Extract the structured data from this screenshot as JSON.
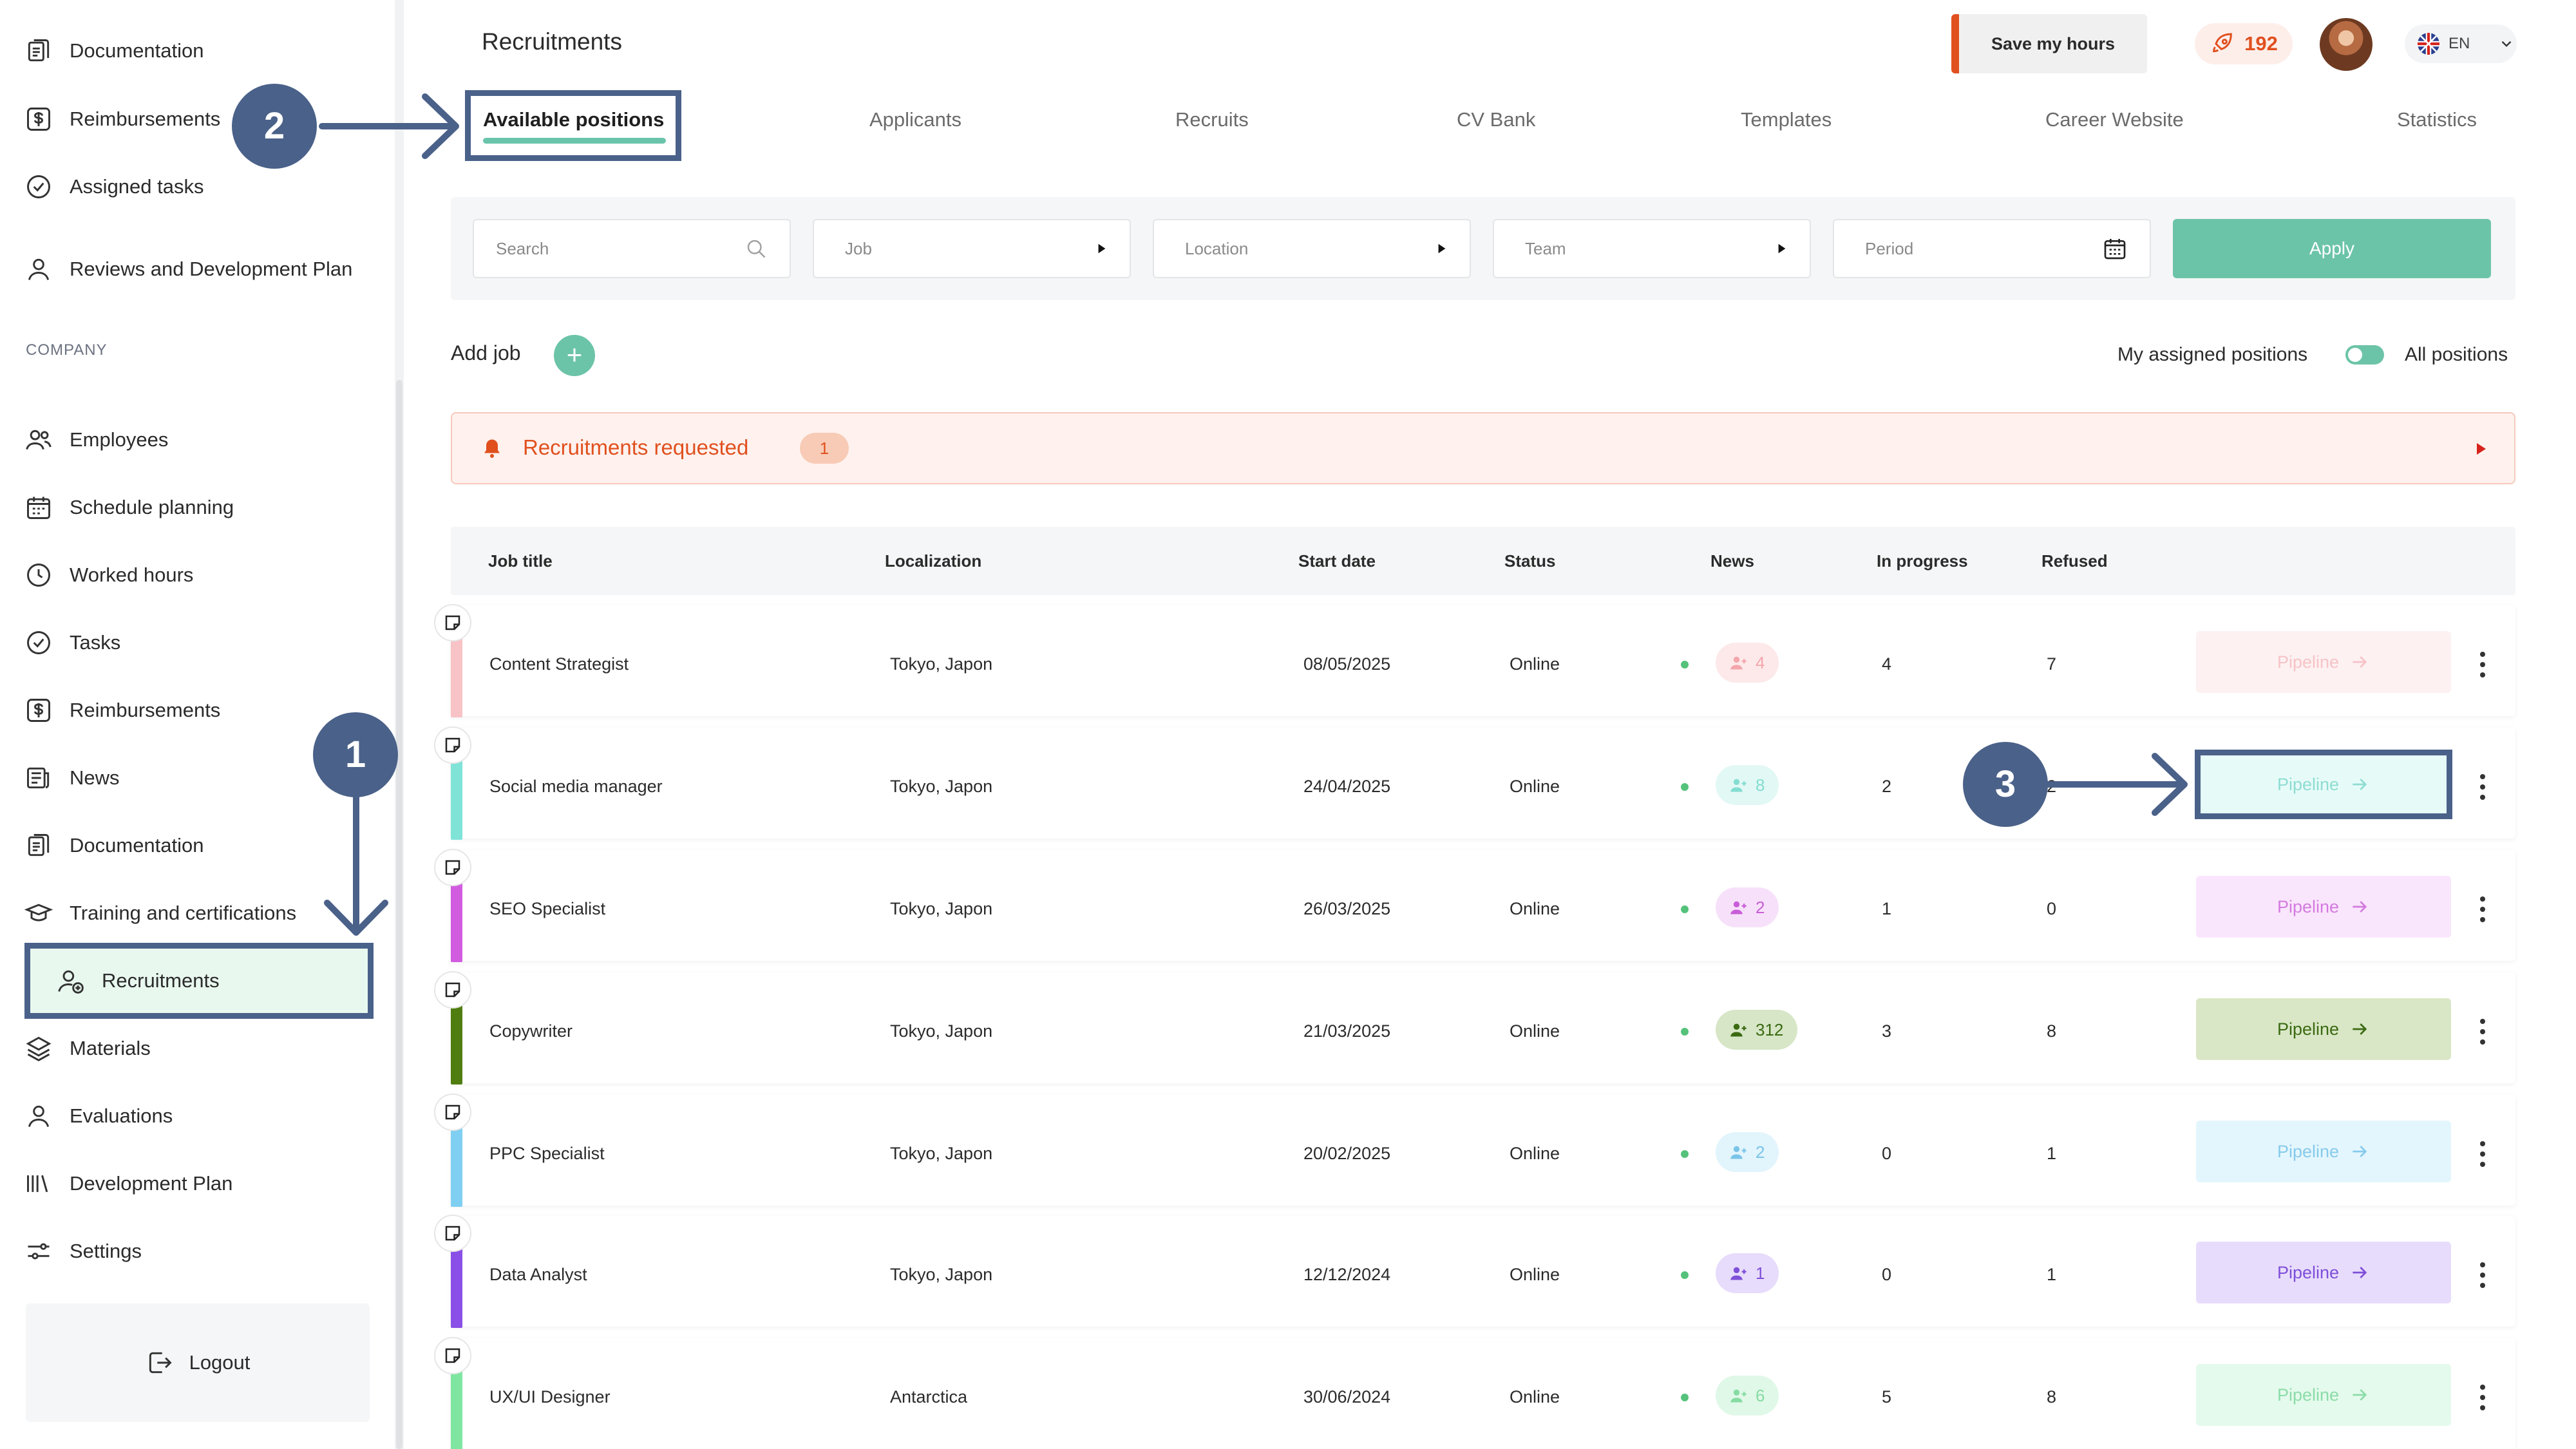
{
  "header": {
    "title": "Recruitments",
    "save_hours_label": "Save my hours",
    "points": "192",
    "language": "EN"
  },
  "tabs": [
    {
      "label": "Available positions"
    },
    {
      "label": "Applicants"
    },
    {
      "label": "Recruits"
    },
    {
      "label": "CV Bank"
    },
    {
      "label": "Templates"
    },
    {
      "label": "Career Website"
    },
    {
      "label": "Statistics"
    }
  ],
  "sidebar": {
    "top_items": [
      {
        "label": "Documentation",
        "icon": "documentation-icon"
      },
      {
        "label": "Reimbursements",
        "icon": "dollar-icon"
      },
      {
        "label": "Assigned tasks",
        "icon": "check-circle-icon"
      },
      {
        "label": "Reviews and Development Plan",
        "icon": "person-icon"
      }
    ],
    "section_label": "COMPANY",
    "company_items": [
      {
        "label": "Employees",
        "icon": "users-icon"
      },
      {
        "label": "Schedule planning",
        "icon": "calendar-icon"
      },
      {
        "label": "Worked hours",
        "icon": "clock-icon"
      },
      {
        "label": "Tasks",
        "icon": "check-circle-icon"
      },
      {
        "label": "Reimbursements",
        "icon": "dollar-icon"
      },
      {
        "label": "News",
        "icon": "news-icon"
      },
      {
        "label": "Documentation",
        "icon": "documentation-icon"
      },
      {
        "label": "Training and certifications",
        "icon": "graduation-cap-icon"
      },
      {
        "label": "Recruitments",
        "icon": "user-add-icon"
      },
      {
        "label": "Materials",
        "icon": "layers-icon"
      },
      {
        "label": "Evaluations",
        "icon": "person-icon"
      },
      {
        "label": "Development Plan",
        "icon": "bars-icon"
      },
      {
        "label": "Settings",
        "icon": "sliders-icon"
      }
    ],
    "logout_label": "Logout"
  },
  "filters": {
    "search_placeholder": "Search",
    "job_label": "Job",
    "location_label": "Location",
    "team_label": "Team",
    "period_label": "Period",
    "apply_label": "Apply"
  },
  "actions": {
    "add_job_label": "Add job",
    "my_assigned_label": "My assigned positions",
    "all_positions_label": "All positions"
  },
  "requested": {
    "label": "Recruitments requested",
    "count": "1"
  },
  "table": {
    "headers": {
      "job_title": "Job title",
      "localization": "Localization",
      "start_date": "Start date",
      "status": "Status",
      "news": "News",
      "in_progress": "In progress",
      "refused": "Refused"
    },
    "rows": [
      {
        "title": "Content Strategist",
        "location": "Tokyo, Japon",
        "start": "08/05/2025",
        "status": "Online",
        "news": "4",
        "in_progress": "4",
        "refused": "7",
        "pipeline": "Pipeline",
        "color": "#f7c3c6",
        "pill_bg": "#fde9ea",
        "pill_fg": "#f3a6ab",
        "pipe_bg": "#fdf1f2",
        "pipe_fg": "#f7c3c6"
      },
      {
        "title": "Social media manager",
        "location": "Tokyo, Japon",
        "start": "24/04/2025",
        "status": "Online",
        "news": "8",
        "in_progress": "2",
        "refused": "2",
        "pipeline": "Pipeline",
        "color": "#7fe3d8",
        "pill_bg": "#e2f8f5",
        "pill_fg": "#83ddd1",
        "pipe_bg": "#e6fbf8",
        "pipe_fg": "#8fdcd2"
      },
      {
        "title": "SEO Specialist",
        "location": "Tokyo, Japon",
        "start": "26/03/2025",
        "status": "Online",
        "news": "2",
        "in_progress": "1",
        "refused": "0",
        "pipeline": "Pipeline",
        "color": "#d25ce0",
        "pill_bg": "#f7e1fa",
        "pill_fg": "#c95dd8",
        "pipe_bg": "#fae6fc",
        "pipe_fg": "#d47be0"
      },
      {
        "title": "Copywriter",
        "location": "Tokyo, Japon",
        "start": "21/03/2025",
        "status": "Online",
        "news": "312",
        "in_progress": "3",
        "refused": "8",
        "pipeline": "Pipeline",
        "color": "#4f7d0f",
        "pill_bg": "#d6e6c6",
        "pill_fg": "#3b6a12",
        "pipe_bg": "#d9e7c6",
        "pipe_fg": "#3b6a12"
      },
      {
        "title": "PPC Specialist",
        "location": "Tokyo, Japon",
        "start": "20/02/2025",
        "status": "Online",
        "news": "2",
        "in_progress": "0",
        "refused": "1",
        "pipeline": "Pipeline",
        "color": "#7fcff2",
        "pill_bg": "#e2f4fc",
        "pill_fg": "#79c4e8",
        "pipe_bg": "#e4f6fd",
        "pipe_fg": "#86cbec"
      },
      {
        "title": "Data Analyst",
        "location": "Tokyo, Japon",
        "start": "12/12/2024",
        "status": "Online",
        "news": "1",
        "in_progress": "0",
        "refused": "1",
        "pipeline": "Pipeline",
        "color": "#8a4fe6",
        "pill_bg": "#e7dcfb",
        "pill_fg": "#7e4fd8",
        "pipe_bg": "#e8dcfc",
        "pipe_fg": "#7e4fd8"
      },
      {
        "title": "UX/UI Designer",
        "location": "Antarctica",
        "start": "30/06/2024",
        "status": "Online",
        "news": "6",
        "in_progress": "5",
        "refused": "8",
        "pipeline": "Pipeline",
        "color": "#7fe6a1",
        "pill_bg": "#e0f8e8",
        "pill_fg": "#86dca3",
        "pipe_bg": "#e4faec",
        "pipe_fg": "#8cdca9"
      }
    ]
  },
  "annotations": [
    "1",
    "2",
    "3"
  ],
  "colors": {
    "accent": "#6cc4a8",
    "annotation": "#4a6189",
    "alert": "#e0501f"
  }
}
